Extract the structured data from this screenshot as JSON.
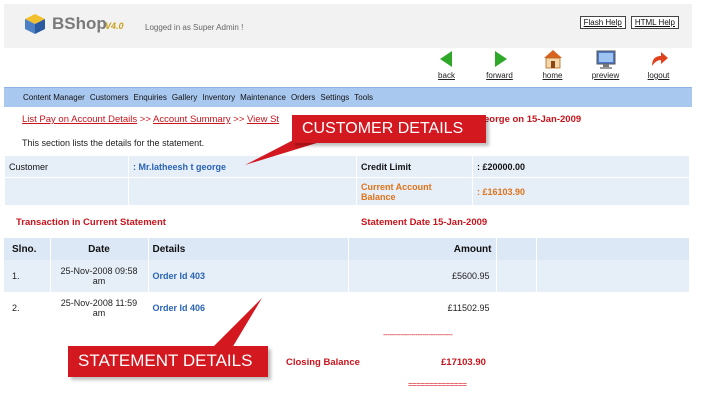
{
  "app": {
    "name": "BShop",
    "version": "V4.0",
    "logged_in_text": "Logged in as Super Admin !"
  },
  "help": {
    "flash_help": "Flash Help",
    "html_help": "HTML Help"
  },
  "nav": [
    {
      "label": "back",
      "icon": "back-arrow-icon"
    },
    {
      "label": "forward",
      "icon": "forward-arrow-icon"
    },
    {
      "label": "home",
      "icon": "home-icon"
    },
    {
      "label": "preview",
      "icon": "monitor-icon"
    },
    {
      "label": "logout",
      "icon": "logout-arrow-icon"
    }
  ],
  "menu": [
    "Content Manager",
    "Customers",
    "Enquiries",
    "Gallery",
    "Inventory",
    "Maintenance",
    "Orders",
    "Settings",
    "Tools"
  ],
  "breadcrumb": {
    "item1": "List Pay on Account Details",
    "sep": ">>",
    "item2": "Account Summary",
    "item3": "View St",
    "tail": "eorge on 15-Jan-2009"
  },
  "description": "This section lists the details for the statement.",
  "customer": {
    "label": "Customer",
    "name": ": Mr.latheesh t george",
    "credit_limit_label": "Credit Limit",
    "credit_limit_value": ": £20000.00",
    "balance_label": "Current Account Balance",
    "balance_value": ": £16103.90"
  },
  "transactions": {
    "title": "Transaction in Current Statement",
    "statement_date": "Statement Date 15-Jan-2009",
    "headers": {
      "slno": "Slno.",
      "date": "Date",
      "details": "Details",
      "amount": "Amount"
    },
    "rows": [
      {
        "slno": "1.",
        "date": "25-Nov-2008 09:58 am",
        "details": "Order Id 403",
        "amount": "£5600.95"
      },
      {
        "slno": "2.",
        "date": "25-Nov-2008 11:59 am",
        "details": "Order Id 406",
        "amount": "£11502.95"
      }
    ],
    "dashes": "--------------------------------",
    "closing_label": "Closing Balance",
    "closing_value": "£17103.90",
    "double_dashes": "=============="
  },
  "callouts": {
    "customer": "CUSTOMER DETAILS",
    "statement": "STATEMENT DETAILS"
  },
  "colors": {
    "menu_bg": "#a9c8ef",
    "accent_red": "#c8141c",
    "link_blue": "#2a63b5",
    "orange": "#e07318"
  }
}
